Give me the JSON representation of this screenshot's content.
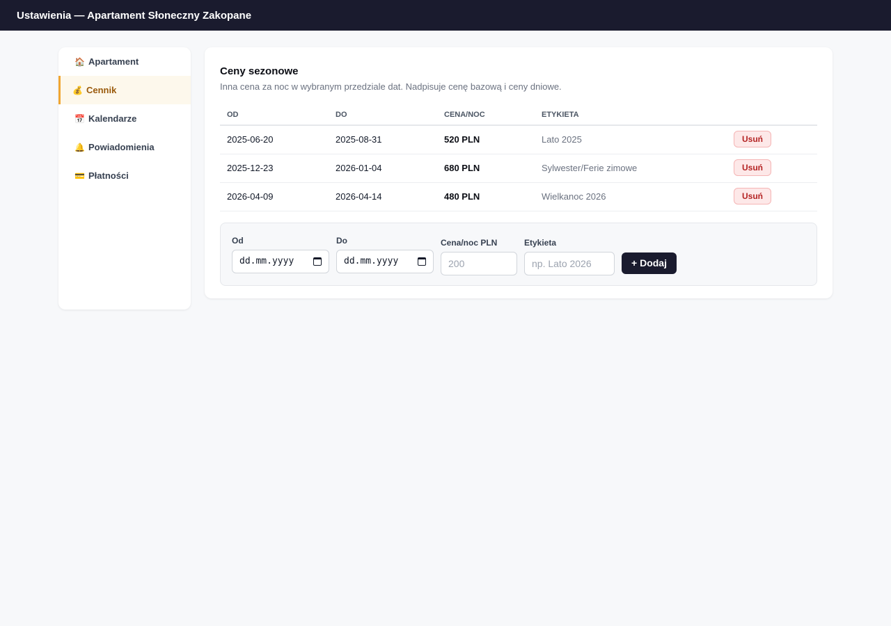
{
  "header": {
    "title": "Ustawienia — Apartament Słoneczny Zakopane"
  },
  "sidebar": {
    "items": [
      {
        "icon": "🏠",
        "icon_name": "house-icon",
        "label": "Apartament"
      },
      {
        "icon": "💰",
        "icon_name": "money-bag-icon",
        "label": "Cennik",
        "active": true
      },
      {
        "icon": "📅",
        "icon_name": "calendar-icon",
        "label": "Kalendarze"
      },
      {
        "icon": "🔔",
        "icon_name": "bell-icon",
        "label": "Powiadomienia"
      },
      {
        "icon": "💳",
        "icon_name": "credit-card-icon",
        "label": "Płatności"
      }
    ]
  },
  "main": {
    "title": "Ceny sezonowe",
    "subtitle": "Inna cena za noc w wybranym przedziale dat. Nadpisuje cenę bazową i ceny dniowe.",
    "table": {
      "headers": [
        "OD",
        "DO",
        "CENA/NOC",
        "ETYKIETA",
        ""
      ],
      "rows": [
        {
          "from": "2025-06-20",
          "to": "2025-08-31",
          "price": "520 PLN",
          "label": "Lato 2025",
          "action": "Usuń"
        },
        {
          "from": "2025-12-23",
          "to": "2026-01-04",
          "price": "680 PLN",
          "label": "Sylwester/Ferie zimowe",
          "action": "Usuń"
        },
        {
          "from": "2026-04-09",
          "to": "2026-04-14",
          "price": "480 PLN",
          "label": "Wielkanoc 2026",
          "action": "Usuń"
        }
      ]
    },
    "form": {
      "from_label": "Od",
      "from_value": "dd.mm.yyyy",
      "to_label": "Do",
      "to_value": "dd.mm.yyyy",
      "price_label": "Cena/noc PLN",
      "price_placeholder": "200",
      "tag_label": "Etykieta",
      "tag_placeholder": "np. Lato 2026",
      "add_button": "+ Dodaj"
    }
  },
  "colors": {
    "topbar": "#1a1b2e",
    "accent": "#f0a632",
    "danger": "#b42323"
  }
}
